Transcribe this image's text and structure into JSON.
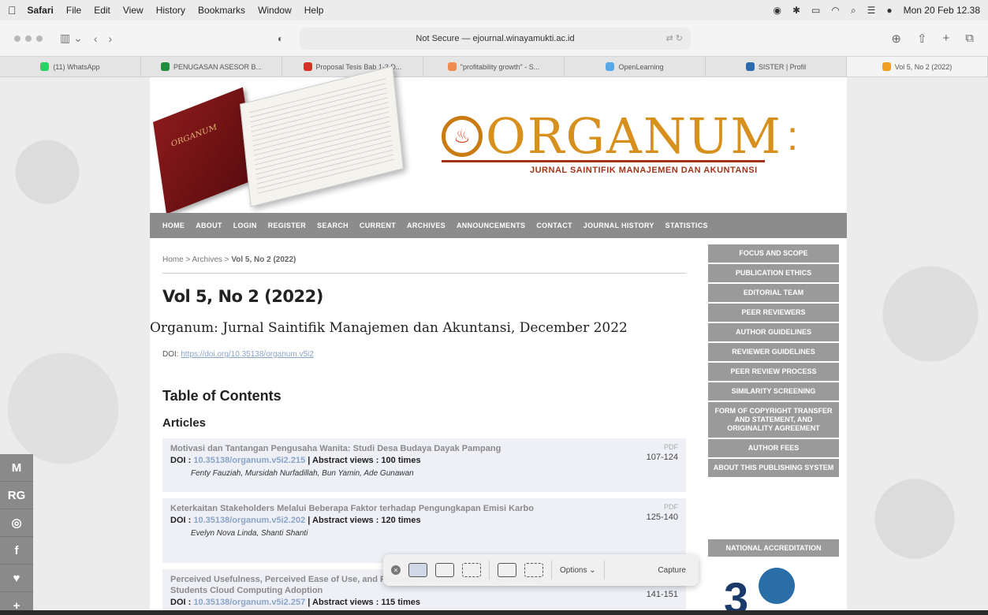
{
  "menubar": {
    "app": "Safari",
    "items": [
      "File",
      "Edit",
      "View",
      "History",
      "Bookmarks",
      "Window",
      "Help"
    ],
    "clock": "Mon 20 Feb 12.38"
  },
  "toolbar": {
    "url": "Not Secure — ejournal.winayamukti.ac.id"
  },
  "tabs": [
    {
      "label": "(11) WhatsApp",
      "color": "#25d366"
    },
    {
      "label": "PENUGASAN ASESOR B...",
      "color": "#1e8e3e"
    },
    {
      "label": "Proposal Tesis Bab 1-3 D...",
      "color": "#d93025"
    },
    {
      "label": "\"profitability growth\" - S...",
      "color": "#f28b50"
    },
    {
      "label": "OpenLearning",
      "color": "#5aa9e6"
    },
    {
      "label": "SISTER | Profil",
      "color": "#2b6cb0"
    },
    {
      "label": "Vol 5, No 2 (2022)",
      "color": "#f0a020"
    }
  ],
  "journal": {
    "logo": "ORGANUM",
    "subtitle": "JURNAL SAINTIFIK MANAJEMEN DAN AKUNTANSI",
    "book_label": "ORGANUM"
  },
  "nav": [
    "HOME",
    "ABOUT",
    "LOGIN",
    "REGISTER",
    "SEARCH",
    "CURRENT",
    "ARCHIVES",
    "ANNOUNCEMENTS",
    "CONTACT",
    "JOURNAL HISTORY",
    "STATISTICS"
  ],
  "breadcrumb": {
    "home": "Home",
    "archives": "Archives",
    "current": "Vol 5, No 2 (2022)"
  },
  "issue": {
    "title": "Vol 5, No 2 (2022)",
    "description": "Organum: Jurnal Saintifik Manajemen dan Akuntansi, December 2022",
    "doi_label": "DOI:",
    "doi_url": "https://doi.org/10.35138/organum.v5i2"
  },
  "toc_heading": "Table of Contents",
  "articles_heading": "Articles",
  "articles": [
    {
      "title": "Motivasi dan Tantangan Pengusaha Wanita: Studi Desa Budaya Dayak Pampang",
      "doi_label": "DOI :",
      "doi": "10.35138/organum.v5i2.215",
      "views": "| Abstract views : 100 times",
      "authors": "Fenty Fauziah, Mursidah Nurfadillah, Bun Yamin, Ade Gunawan",
      "pdf": "PDF",
      "pages": "107-124"
    },
    {
      "title": "Keterkaitan Stakeholders Melalui Beberapa Faktor terhadap Pengungkapan Emisi Karbo",
      "doi_label": "DOI :",
      "doi": "10.35138/organum.v5i2.202",
      "views": "| Abstract views : 120 times",
      "authors": "Evelyn Nova Linda, Shanti Shanti",
      "pdf": "PDF",
      "pages": "125-140"
    },
    {
      "title": "Perceived Usefulness, Perceived Ease of Use, and Personal Innovativeness of Accounting Students Cloud Computing Adoption",
      "doi_label": "DOI :",
      "doi": "10.35138/organum.v5i2.257",
      "views": "| Abstract views : 115 times",
      "pages": "141-151"
    }
  ],
  "sidebar": [
    "FOCUS AND SCOPE",
    "PUBLICATION ETHICS",
    "EDITORIAL TEAM",
    "PEER REVIEWERS",
    "AUTHOR GUIDELINES",
    "REVIEWER GUIDELINES",
    "PEER REVIEW PROCESS",
    "SIMILARITY SCREENING",
    "FORM OF COPYRIGHT TRANSFER AND STATEMENT, AND ORIGINALITY AGREEMENT",
    "AUTHOR FEES",
    "ABOUT THIS PUBLISHING SYSTEM"
  ],
  "national_accreditation": "NATIONAL ACCREDITATION",
  "accreditation_seal": "3",
  "social": [
    "M",
    "RG",
    "wa",
    "f",
    "tw",
    "+"
  ],
  "capture_bar": {
    "options": "Options",
    "capture": "Capture"
  }
}
